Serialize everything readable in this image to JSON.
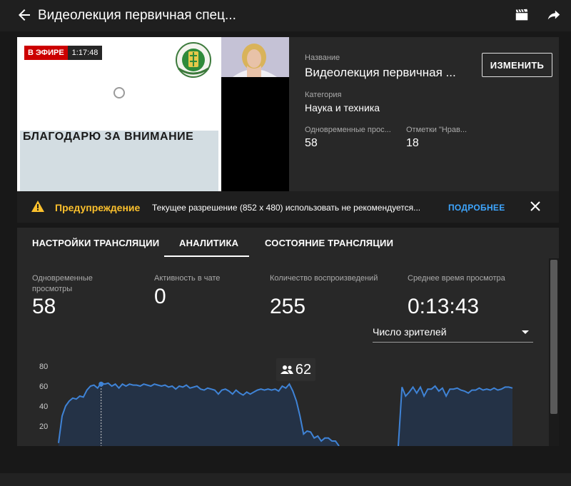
{
  "header": {
    "title": "Видеолекция первичная спец...",
    "back_icon": "arrow-back-icon",
    "clapper_icon": "clapperboard-icon",
    "share_icon": "share-icon"
  },
  "preview": {
    "live_label": "В ЭФИРЕ",
    "live_time": "1:17:48",
    "slide_text": "БЛАГОДАРЮ ЗА ВНИМАНИЕ"
  },
  "details": {
    "title_label": "Название",
    "title_value": "Видеолекция первичная ...",
    "category_label": "Категория",
    "category_value": "Наука и техника",
    "concurrent_label": "Одновременные прос...",
    "concurrent_value": "58",
    "likes_label": "Отметки \"Нрав...",
    "likes_value": "18",
    "edit_button": "ИЗМЕНИТЬ"
  },
  "warning": {
    "title": "Предупреждение",
    "text": "Текущее разрешение (852 x 480) использовать не рекомендуется...",
    "link": "ПОДРОБНЕЕ"
  },
  "tabs": [
    {
      "label": "НАСТРОЙКИ ТРАНСЛЯЦИИ"
    },
    {
      "label": "АНАЛИТИКА",
      "active": true
    },
    {
      "label": "СОСТОЯНИЕ ТРАНСЛЯЦИИ"
    }
  ],
  "metrics": [
    {
      "label": "Одновременные просмотры",
      "value": "58"
    },
    {
      "label": "Активность в чате",
      "value": "0"
    },
    {
      "label": "Количество воспроизведений",
      "value": "255"
    },
    {
      "label": "Среднее время просмотра",
      "value": "0:13:43"
    }
  ],
  "dropdown": {
    "selected": "Число зрителей"
  },
  "tooltip": {
    "value": "62"
  },
  "colors": {
    "line": "#3f83d6",
    "area": "#243246",
    "live_red": "#cc0000",
    "warning_yellow": "#fbc02d",
    "link_blue": "#3ea6ff"
  },
  "chart_data": {
    "type": "area",
    "yticks": [
      20,
      40,
      60,
      80
    ],
    "ylim": [
      0,
      85
    ],
    "highlight_value": 62,
    "series": [
      {
        "segment": 1,
        "values": [
          3,
          30,
          40,
          45,
          48,
          47,
          50,
          49,
          56,
          60,
          61,
          58,
          63,
          62,
          63,
          60,
          62,
          58,
          62,
          60,
          62,
          61,
          61,
          60,
          62,
          61,
          60,
          62,
          61,
          60,
          61,
          59,
          60,
          57,
          60,
          59,
          61,
          58,
          59,
          60,
          57,
          56,
          58,
          57,
          56,
          52,
          56,
          57,
          55,
          52,
          56,
          53,
          51,
          54,
          52,
          54,
          56,
          57,
          56,
          57,
          56,
          57,
          55,
          60,
          58,
          62,
          55,
          45,
          30,
          12,
          15,
          14,
          8,
          10,
          5,
          8,
          8,
          5,
          5,
          0
        ]
      },
      {
        "segment": 2,
        "values": [
          0,
          59,
          50,
          54,
          59,
          53,
          59,
          50,
          57,
          57,
          60,
          55,
          58,
          50,
          57,
          57,
          58,
          56,
          55,
          53,
          56,
          56,
          58,
          56,
          57,
          56,
          58,
          56,
          57,
          59,
          59,
          58
        ]
      }
    ]
  }
}
